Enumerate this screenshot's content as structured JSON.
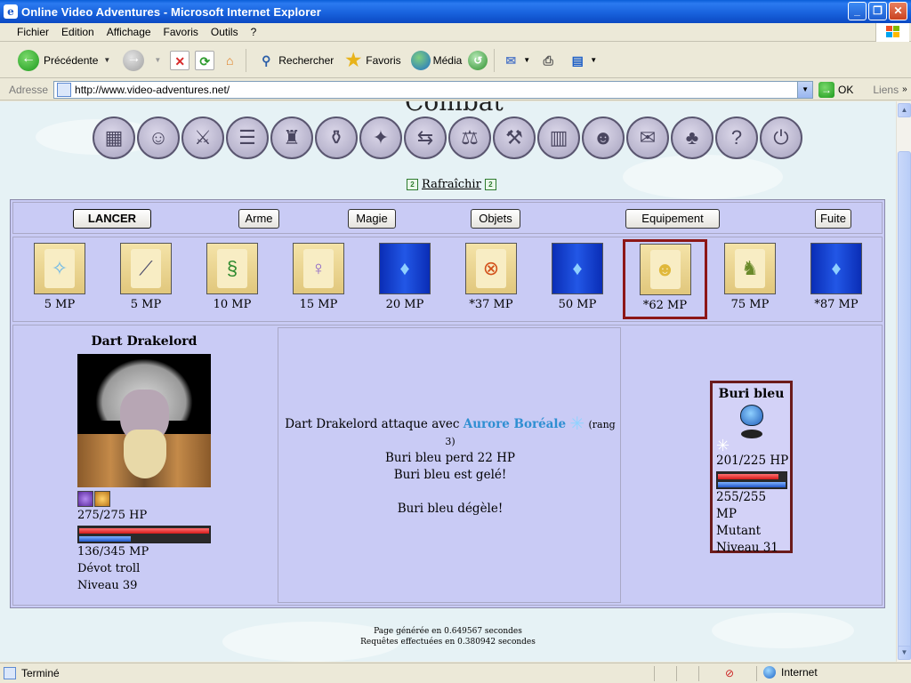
{
  "window": {
    "title": "Online Video Adventures - Microsoft Internet Explorer",
    "app_icon": "e"
  },
  "menu": [
    "Fichier",
    "Edition",
    "Affichage",
    "Favoris",
    "Outils",
    "?"
  ],
  "toolbar": {
    "back": "Précédente",
    "search": "Rechercher",
    "favorites": "Favoris",
    "media": "Média"
  },
  "address": {
    "label": "Adresse",
    "url": "http://www.video-adventures.net/",
    "go": "OK",
    "links": "Liens"
  },
  "page": {
    "heading_clipped": "Combat",
    "refresh": "Rafraîchir",
    "actions": [
      "LANCER",
      "Arme",
      "Magie",
      "Objets",
      "Equipement",
      "Fuite"
    ],
    "spells": [
      {
        "cost": "5 MP",
        "icon": "angel-icon",
        "style": "parchment"
      },
      {
        "cost": "5 MP",
        "icon": "wand-icon",
        "style": "parchment"
      },
      {
        "cost": "10 MP",
        "icon": "vine-icon",
        "style": "parchment"
      },
      {
        "cost": "15 MP",
        "icon": "figure-icon",
        "style": "parchment"
      },
      {
        "cost": "20 MP",
        "icon": "blue-flame-icon",
        "style": "blue"
      },
      {
        "cost": "*37 MP",
        "icon": "fire-rune-icon",
        "style": "parchment"
      },
      {
        "cost": "50 MP",
        "icon": "blue-flame-icon",
        "style": "blue"
      },
      {
        "cost": "*62 MP",
        "icon": "angel-knight-icon",
        "style": "parchment",
        "selected": true
      },
      {
        "cost": "75 MP",
        "icon": "goblin-warrior-icon",
        "style": "parchment"
      },
      {
        "cost": "*87 MP",
        "icon": "blue-flame-icon",
        "style": "blue"
      }
    ],
    "player": {
      "name": "Dart Drakelord",
      "hp": "275/275 HP",
      "hp_fraction": 1.0,
      "mp": "136/345 MP",
      "mp_fraction": 0.394,
      "class": "Dévot troll",
      "level": "Niveau 39"
    },
    "log": {
      "line1_prefix": "Dart Drakelord attaque avec",
      "spell": "Aurore Boréale",
      "rank": "(rang 3)",
      "line2": "Buri bleu perd 22 HP",
      "line3": "Buri bleu est gelé!",
      "line4": "Buri bleu dégèle!"
    },
    "enemy": {
      "name": "Buri bleu",
      "hp": "201/225 HP",
      "hp_fraction": 0.893,
      "mp": "255/255 MP",
      "mp_fraction": 1.0,
      "type": "Mutant",
      "level": "Niveau 31"
    },
    "footer": {
      "line1": "Page générée en 0.649567 secondes",
      "line2": "Requêtes effectuées en 0.380942 secondes"
    }
  },
  "status": {
    "text": "Terminé",
    "zone": "Internet"
  }
}
